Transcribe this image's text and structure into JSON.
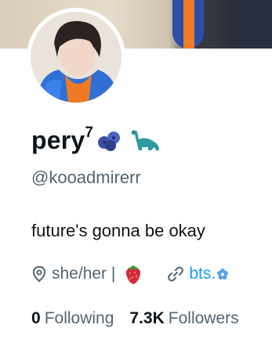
{
  "profile": {
    "display_name": "pery",
    "name_superscript": "7",
    "name_emoji_1": "blueberries-icon",
    "name_emoji_2": "dinosaur-icon",
    "handle": "@kooadmirerr",
    "bio": "future's gonna be okay",
    "location_text": "she/her |",
    "location_emoji": "strawberry-icon",
    "link_text": "bts.",
    "link_emoji": "blue-flower-icon",
    "following_count": "0",
    "following_label": "Following",
    "followers_count": "7.3K",
    "followers_label": "Followers"
  },
  "colors": {
    "text_primary": "#0f1419",
    "text_secondary": "#536471",
    "link": "#1d9bf0"
  }
}
